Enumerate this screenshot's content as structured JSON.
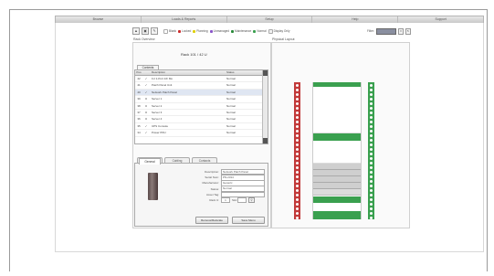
{
  "menu": [
    "Browse",
    "Loads & Reports",
    "Setup",
    "Help",
    "Support"
  ],
  "toolbar": {
    "legend": [
      {
        "label": "Blank",
        "color": "#ffffff"
      },
      {
        "label": "Locked",
        "color": "#cc2b2b"
      },
      {
        "label": "Planning",
        "color": "#e0d000"
      },
      {
        "label": "Unmanaged",
        "color": "#8a56c9"
      },
      {
        "label": "Maintenance",
        "color": "#2a8a3a"
      },
      {
        "label": "Normal",
        "color": "#3aa04f"
      },
      {
        "label": "Display Only",
        "color": "#f0f0f0"
      }
    ],
    "filter_label": "Filter:"
  },
  "rack_overview": {
    "title": "Rack Overview",
    "rack_name": "Rack 101 / 42 U",
    "tab": "Contents",
    "columns": [
      "Pos",
      "Description",
      "Status"
    ],
    "rows": [
      {
        "pos": "42",
        "chk": "✓",
        "desc": "1U 1-Port 1/F Mo",
        "status": "Normal"
      },
      {
        "pos": "41",
        "chk": "✓",
        "desc": "Patch Panel Unit",
        "status": "Normal"
      },
      {
        "pos": "40",
        "chk": "✓",
        "desc": "Network Patch Panel",
        "status": "Normal"
      },
      {
        "pos": "39",
        "chk": "⊙",
        "desc": "Server 1",
        "status": "Normal"
      },
      {
        "pos": "38",
        "chk": "⊙",
        "desc": "Server 2",
        "status": "Normal"
      },
      {
        "pos": "37",
        "chk": "⊙",
        "desc": "Server 3",
        "status": "Normal"
      },
      {
        "pos": "36",
        "chk": "⊙",
        "desc": "Server 4",
        "status": "Normal"
      },
      {
        "pos": "35",
        "chk": "✓",
        "desc": "UPS Console",
        "status": "Normal"
      },
      {
        "pos": "34",
        "chk": "✓",
        "desc": "Power PDU",
        "status": "Normal"
      }
    ]
  },
  "details": {
    "tabs": [
      "Details",
      "Cabling",
      "Contacts"
    ],
    "general_tab": "General",
    "fields": [
      {
        "label": "Description:",
        "value": "Network Patch Panel"
      },
      {
        "label": "Serial Num:",
        "value": "PN-2314"
      },
      {
        "label": "Manufacturer:",
        "value": "Generic"
      },
      {
        "label": "Status:",
        "value": "Normal"
      },
      {
        "label": "Asset Tag:",
        "value": ""
      }
    ],
    "rack_u_label": "Rack U:",
    "rack_u_value": "1",
    "rack_u_label2": "Slot:",
    "buttons": [
      "Remove/Relocate",
      "Save Menu"
    ]
  },
  "physical_layout": {
    "title": "Physical Layout",
    "colors": {
      "left_rail": "#c23a3a",
      "right_rail": "#3aa04f",
      "device_green": "#3aa04f",
      "device_gray": "#cfcfcf"
    }
  }
}
